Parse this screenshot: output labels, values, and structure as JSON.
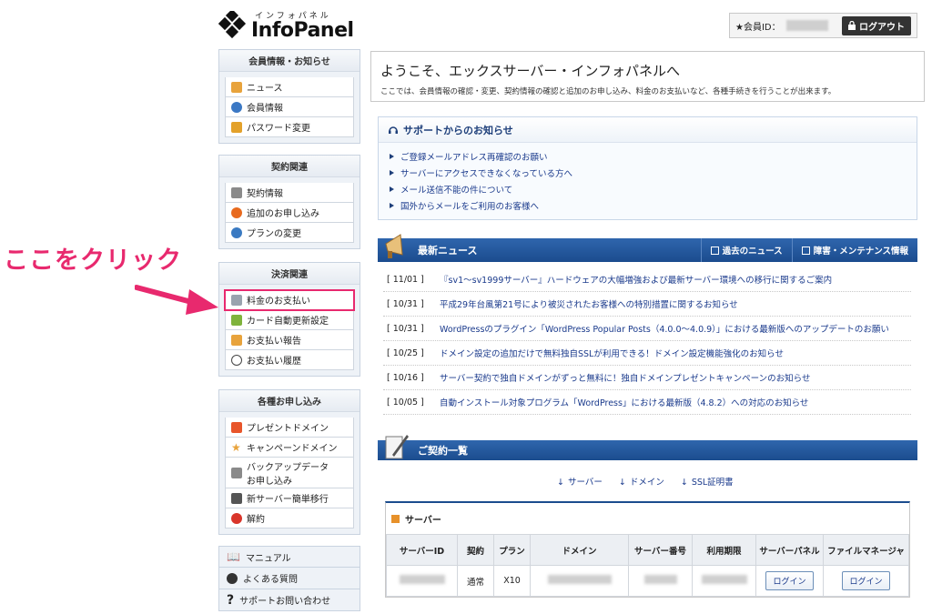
{
  "logo": {
    "kana": "インフォパネル",
    "name": "InfoPanel"
  },
  "header": {
    "member_label": "★会員ID：",
    "logout_label": "ログアウト"
  },
  "callout": {
    "text": "ここをクリック"
  },
  "sidebar": {
    "groups": [
      {
        "title": "会員情報・お知らせ",
        "items": [
          {
            "label": "ニュース"
          },
          {
            "label": "会員情報"
          },
          {
            "label": "パスワード変更"
          }
        ]
      },
      {
        "title": "契約関連",
        "items": [
          {
            "label": "契約情報"
          },
          {
            "label": "追加のお申し込み"
          },
          {
            "label": "プランの変更"
          }
        ]
      },
      {
        "title": "決済関連",
        "items": [
          {
            "label": "料金のお支払い"
          },
          {
            "label": "カード自動更新設定"
          },
          {
            "label": "お支払い報告"
          },
          {
            "label": "お支払い履歴"
          }
        ]
      },
      {
        "title": "各種お申し込み",
        "items": [
          {
            "label": "プレゼントドメイン"
          },
          {
            "label": "キャンペーンドメイン"
          },
          {
            "label": "バックアップデータ",
            "label2": "お申し込み"
          },
          {
            "label": "新サーバー簡単移行"
          },
          {
            "label": "解約"
          }
        ]
      }
    ],
    "bottom": [
      {
        "label": "マニュアル"
      },
      {
        "label": "よくある質問"
      },
      {
        "label": "サポートお問い合わせ"
      }
    ]
  },
  "welcome": {
    "title": "ようこそ、エックスサーバー・インフォパネルへ",
    "desc": "ここでは、会員情報の確認・変更、契約情報の確認と追加のお申し込み、料金のお支払いなど、各種手続きを行うことが出来ます。"
  },
  "support": {
    "title": "サポートからのお知らせ",
    "links": [
      "ご登録メールアドレス再確認のお願い",
      "サーバーにアクセスできなくなっている方へ",
      "メール送信不能の件について",
      "国外からメールをご利用のお客様へ"
    ]
  },
  "news": {
    "title": "最新ニュース",
    "past_label": "過去のニュース",
    "maint_label": "障害・メンテナンス情報",
    "items": [
      {
        "date": "[ 11/01 ]",
        "text": "『sv1～sv1999サーバー』ハードウェアの大幅増強および最新サーバー環境への移行に関するご案内"
      },
      {
        "date": "[ 10/31 ]",
        "text": "平成29年台風第21号により被災されたお客様への特別措置に関するお知らせ"
      },
      {
        "date": "[ 10/31 ]",
        "text": "WordPressのプラグイン「WordPress Popular Posts（4.0.0～4.0.9）」における最新版へのアップデートのお願い"
      },
      {
        "date": "[ 10/25 ]",
        "text": "ドメイン設定の追加だけで無料独自SSLが利用できる！ドメイン設定機能強化のお知らせ"
      },
      {
        "date": "[ 10/16 ]",
        "text": "サーバー契約で独自ドメインがずっと無料に！独自ドメインプレゼントキャンペーンのお知らせ"
      },
      {
        "date": "[ 10/05 ]",
        "text": "自動インストール対象プログラム「WordPress」における最新版（4.8.2）への対応のお知らせ"
      }
    ]
  },
  "contract": {
    "title": "ご契約一覧",
    "anchors": [
      "サーバー",
      "ドメイン",
      "SSL証明書"
    ],
    "server_title": "サーバー",
    "columns": [
      "サーバーID",
      "契約",
      "プラン",
      "ドメイン",
      "サーバー番号",
      "利用期限",
      "サーバーパネル",
      "ファイルマネージャ"
    ],
    "row": {
      "contract": "通常",
      "plan": "X10",
      "login1": "ログイン",
      "login2": "ログイン"
    }
  },
  "colors": {
    "accent": "#e8296e",
    "nav": "#1b4c8e"
  }
}
